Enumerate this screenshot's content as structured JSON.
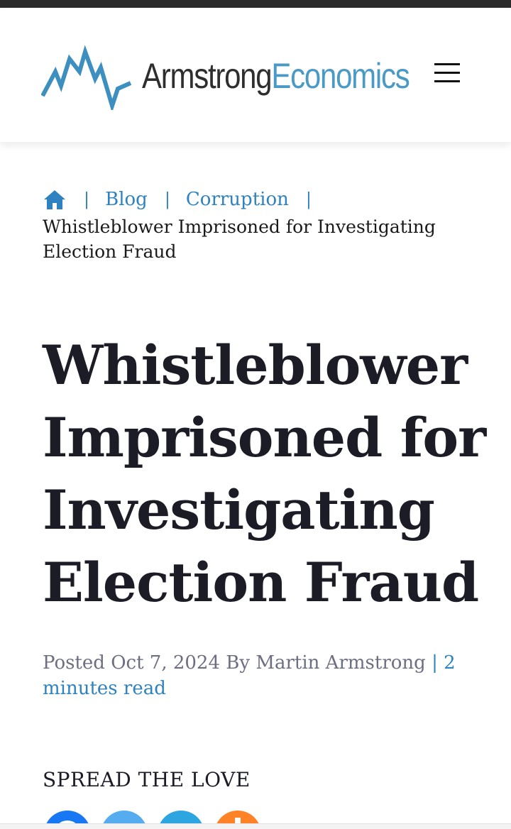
{
  "header": {
    "logo_part1": "Armstrong",
    "logo_part2": "Economics",
    "menu_icon": "hamburger-menu-icon"
  },
  "breadcrumb": {
    "home_icon": "home-icon",
    "items": [
      "Blog",
      "Corruption"
    ],
    "separator": "|",
    "current": "Whistleblower Imprisoned for Investigating Election Fraud"
  },
  "article": {
    "title": "Whistleblower Imprisoned for Investigating Election Fraud",
    "posted_prefix": "Posted",
    "date": "Oct 7, 2024",
    "by": "By",
    "author": "Martin Armstrong",
    "read_time": "| 2 minutes read"
  },
  "share": {
    "heading": "SPREAD THE LOVE",
    "buttons": [
      {
        "name": "facebook",
        "icon": "facebook-icon",
        "color": "#1877f2"
      },
      {
        "name": "twitter",
        "icon": "twitter-icon",
        "color": "#55acee"
      },
      {
        "name": "telegram",
        "icon": "telegram-icon",
        "color": "#2ca5e0"
      },
      {
        "name": "mix",
        "icon": "mix-icon",
        "color": "#ff8226"
      }
    ]
  },
  "colors": {
    "topbar": "#2b2b2b",
    "link": "#2e82bf",
    "title": "#1b1c26",
    "meta": "#6d6e82",
    "logo_dark": "#2e2e2e",
    "logo_accent": "#4a9ac6"
  }
}
